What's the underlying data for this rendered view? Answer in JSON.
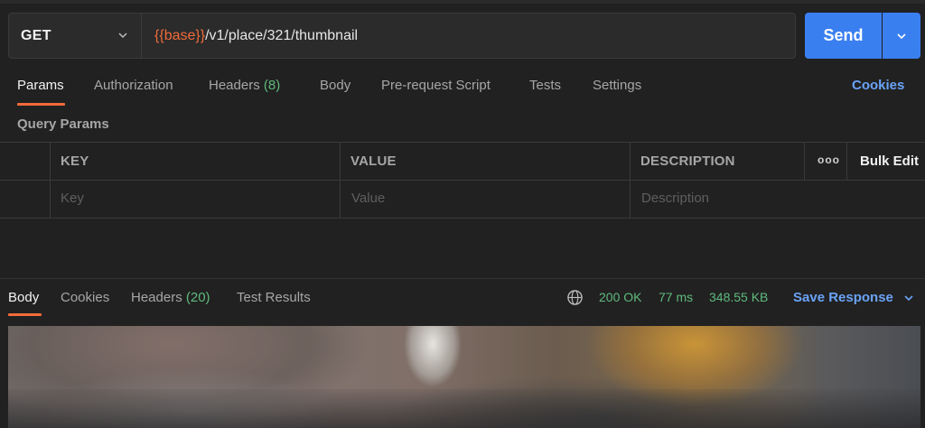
{
  "request": {
    "method": "GET",
    "url_var": "{{base}}",
    "url_path": "/v1/place/321/thumbnail",
    "send_label": "Send"
  },
  "tabs": [
    {
      "label": "Params",
      "active": true
    },
    {
      "label": "Authorization"
    },
    {
      "label": "Headers ",
      "count": "(8)"
    },
    {
      "label": "Body"
    },
    {
      "label": "Pre-request Script"
    },
    {
      "label": "Tests"
    },
    {
      "label": "Settings"
    }
  ],
  "cookies_label": "Cookies",
  "query_params": {
    "title": "Query Params",
    "columns": [
      "KEY",
      "VALUE",
      "DESCRIPTION"
    ],
    "placeholders": [
      "Key",
      "Value",
      "Description"
    ],
    "more_label": "ooo",
    "bulk_edit_label": "Bulk Edit"
  },
  "response": {
    "tabs": [
      {
        "label": "Body",
        "active": true
      },
      {
        "label": "Cookies"
      },
      {
        "label": "Headers ",
        "count": "(20)"
      },
      {
        "label": "Test Results"
      }
    ],
    "status": "200 OK",
    "time": "77 ms",
    "size": "348.55 KB",
    "save_label": "Save Response"
  },
  "colors": {
    "accent": "#f26b3a",
    "primary": "#3a7ff0",
    "link": "#6aa3f7",
    "success": "#5fba7d"
  }
}
